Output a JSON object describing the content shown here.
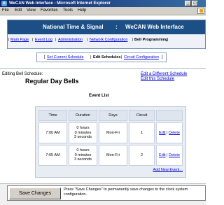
{
  "window": {
    "title": "WeCAN Web Interface - Microsoft Internet Explorer"
  },
  "menu": [
    "File",
    "Edit",
    "View",
    "Favorites",
    "Tools",
    "Help"
  ],
  "header": {
    "title_left": "National Time & Signal",
    "title_sep": ":",
    "title_right": "WeCAN Web Interface",
    "links": [
      "Main Page",
      "Event Log",
      "Administration",
      "Network Configuration",
      "Bell Programming"
    ],
    "active_link": "Bell Programming"
  },
  "subnav": [
    "Set Current Schedule",
    "Edit Schedules",
    "Circuit Configuration"
  ],
  "editing_label": "Editing Bell Schedule:",
  "schedule_name": "Regular Day Bells",
  "right_links": [
    "Edit a Different Schedule",
    "Edit this Schedule"
  ],
  "event_list_label": "Event List",
  "table": {
    "columns": [
      "Time",
      "Duration",
      "Days",
      "Circuit"
    ],
    "rows": [
      {
        "time": "7:00 AM",
        "duration": [
          "0 hours",
          "0 minutes",
          "3 seconds"
        ],
        "days": "Mon-Fri",
        "circuit": "1",
        "edit": "Edit",
        "delete": "Delete"
      },
      {
        "time": "7:05 AM",
        "duration": [
          "0 hours",
          "0 minutes",
          "3 seconds"
        ],
        "days": "Mon-Fri",
        "circuit": "2",
        "edit": "Edit",
        "delete": "Delete"
      }
    ],
    "add_new": "Add New Event..."
  },
  "save_button": "Save Changes",
  "save_note": "Press \"Save Changes\" to permanently save changes to the clock system configuration."
}
